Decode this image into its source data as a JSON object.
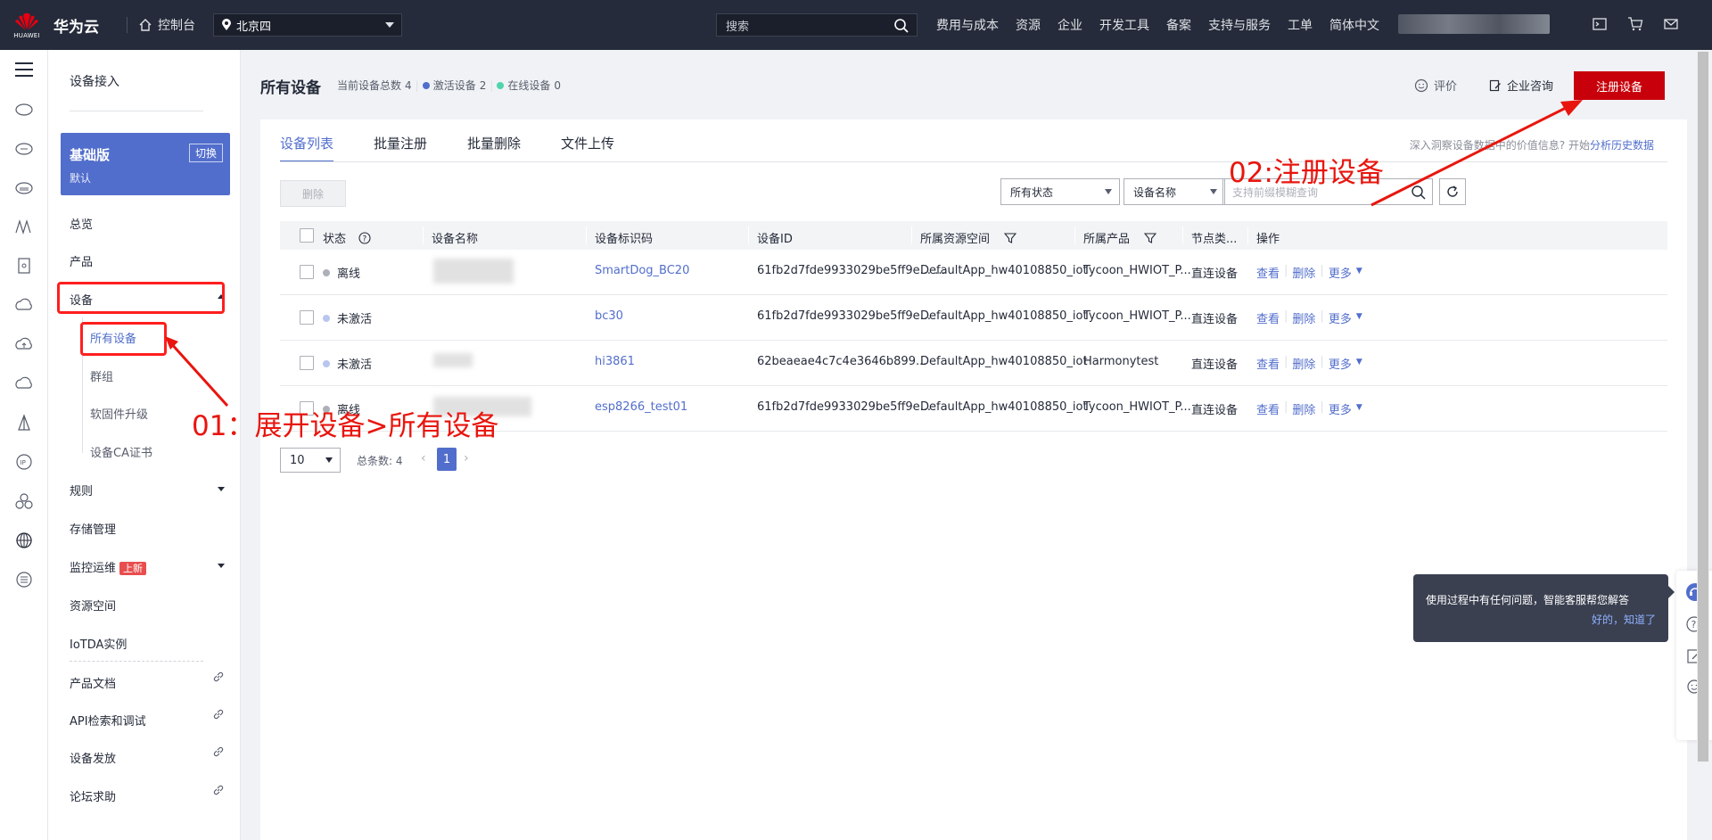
{
  "topbar": {
    "logo_text": "HUAWEI",
    "brand": "华为云",
    "console": "控制台",
    "region": "北京四",
    "search_placeholder": "搜索",
    "nav": [
      "费用与成本",
      "资源",
      "企业",
      "开发工具",
      "备案",
      "支持与服务",
      "工单",
      "简体中文"
    ]
  },
  "sidebar": {
    "title": "设备接入",
    "edition": {
      "name": "基础版",
      "sub": "默认",
      "switch": "切换"
    },
    "items": {
      "overview": "总览",
      "product": "产品",
      "device": "设备",
      "all_devices": "所有设备",
      "group": "群组",
      "firmware": "软固件升级",
      "ca": "设备CA证书",
      "rules": "规则",
      "storage": "存储管理",
      "monitor": "监控运维",
      "monitor_badge": "上新",
      "resource_space": "资源空间",
      "iotda": "IoTDA实例",
      "docs": "产品文档",
      "api": "API检索和调试",
      "provision": "设备发放",
      "forum": "论坛求助"
    }
  },
  "page": {
    "title": "所有设备",
    "total_label": "当前设备总数",
    "total": "4",
    "active_label": "激活设备",
    "active": "2",
    "online_label": "在线设备",
    "online": "0",
    "rate": "评价",
    "consult": "企业咨询",
    "register": "注册设备"
  },
  "tabs": [
    "设备列表",
    "批量注册",
    "批量删除",
    "文件上传"
  ],
  "insight": {
    "text": "深入洞察设备数据中的价值信息? 开始",
    "link": "分析历史数据"
  },
  "toolbar": {
    "delete": "删除",
    "status_filter": "所有状态",
    "field_filter": "设备名称",
    "query_placeholder": "支持前缀模糊查询"
  },
  "table": {
    "headers": [
      "状态",
      "设备名称",
      "设备标识码",
      "设备ID",
      "所属资源空间",
      "所属产品",
      "节点类...",
      "操作"
    ],
    "rows": [
      {
        "status": "离线",
        "dot": "#adb0b8",
        "name": "",
        "identifier": "SmartDog_BC20",
        "id": "61fb2d7fde9933029be5ff9e... ...",
        "space": "DefaultApp_hw40108850_iot",
        "product": "Tycoon_HWIOT_P...",
        "node": "直连设备"
      },
      {
        "status": "未激活",
        "dot": "#b8c5ef",
        "name": "",
        "identifier": "bc30",
        "id": "61fb2d7fde9933029be5ff9e...",
        "space": "DefaultApp_hw40108850_iot",
        "product": "Tycoon_HWIOT_P...",
        "node": "直连设备"
      },
      {
        "status": "未激活",
        "dot": "#b8c5ef",
        "name": "",
        "identifier": "hi3861",
        "id": "62beaeae4c7c4e3646b899...",
        "space": "DefaultApp_hw40108850_iot",
        "product": "Harmonytest",
        "node": "直连设备"
      },
      {
        "status": "离线",
        "dot": "#adb0b8",
        "name": "",
        "identifier": "esp8266_test01",
        "id": "61fb2d7fde9933029be5ff9e...",
        "space": "DefaultApp_hw40108850_iot",
        "product": "Tycoon_HWIOT_P...",
        "node": "直连设备"
      }
    ],
    "ops": {
      "view": "查看",
      "delete": "删除",
      "more": "更多"
    }
  },
  "pagination": {
    "size": "10",
    "total_label": "总条数:",
    "total": "4",
    "current": "1"
  },
  "annotations": {
    "step1": "01：展开设备>所有设备",
    "step2": "02:注册设备"
  },
  "help": {
    "message": "使用过程中有任何问题，智能客服帮您解答",
    "ok": "好的，知道了"
  },
  "colors": {
    "topbar": "#252b3a",
    "accent": "#526ecc",
    "register": "#c7000b",
    "annotation": "#e8150e"
  }
}
